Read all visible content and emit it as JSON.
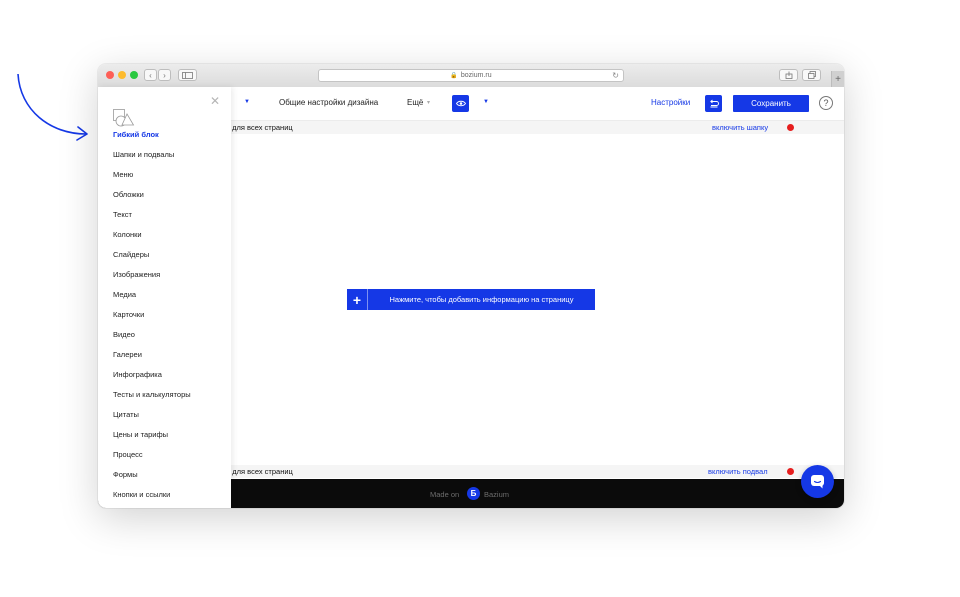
{
  "browser": {
    "url": "bozium.ru"
  },
  "toolbar": {
    "design_settings": "Общие настройки дизайна",
    "more": "Ещё",
    "settings": "Настройки",
    "save": "Сохранить",
    "help": "?"
  },
  "header_bar": {
    "text": "я для всех страниц",
    "link": "включить шапку"
  },
  "canvas": {
    "add_plus": "+",
    "add_label": "Нажмите, чтобы добавить информацию на страницу"
  },
  "footer_bar": {
    "text": "й для всех страниц",
    "link": "включить подвал"
  },
  "footer": {
    "made_on": "Made on",
    "logo_letter": "Б",
    "brand": "Bazium"
  },
  "sidebar": {
    "items": [
      {
        "label": "Гибкий блок",
        "active": true
      },
      {
        "label": "Шапки и подвалы"
      },
      {
        "label": "Меню"
      },
      {
        "label": "Обложки"
      },
      {
        "label": "Текст"
      },
      {
        "label": "Колонки"
      },
      {
        "label": "Слайдеры"
      },
      {
        "label": "Изображения"
      },
      {
        "label": "Медиа"
      },
      {
        "label": "Карточки"
      },
      {
        "label": "Видео"
      },
      {
        "label": "Галереи"
      },
      {
        "label": "Инфографика"
      },
      {
        "label": "Тесты и калькуляторы"
      },
      {
        "label": "Цитаты"
      },
      {
        "label": "Цены и тарифы"
      },
      {
        "label": "Процесс"
      },
      {
        "label": "Формы"
      },
      {
        "label": "Кнопки и ссылки"
      }
    ]
  },
  "colors": {
    "accent": "#1538e6",
    "status_off": "#e61e1e",
    "footer_bg": "#0b0b0b"
  },
  "icons": [
    "arrow-annotation-icon",
    "close-icon",
    "shapes-icon",
    "eye-icon",
    "undo-icon",
    "chat-icon",
    "lock-icon",
    "reload-icon"
  ]
}
